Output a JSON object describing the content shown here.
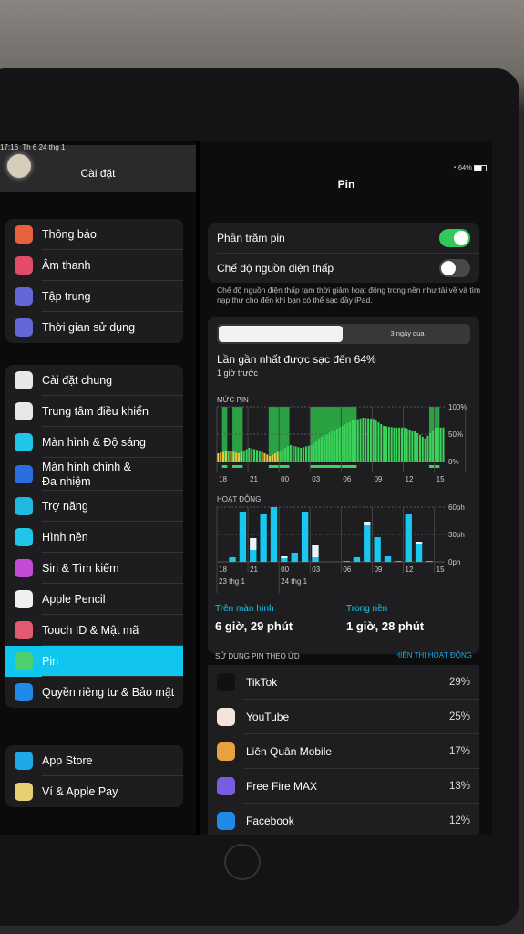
{
  "status": {
    "time": "17:16",
    "date": "Th 6 24 thg 1",
    "battery": "64%"
  },
  "sidebar": {
    "title": "Cài đặt",
    "groups": [
      [
        {
          "label": "Thông báo",
          "icon": "bell-icon",
          "color": "#e8603c"
        },
        {
          "label": "Âm thanh",
          "icon": "speaker-icon",
          "color": "#e44a6a"
        },
        {
          "label": "Tập trung",
          "icon": "moon-icon",
          "color": "#6366d8"
        },
        {
          "label": "Thời gian sử dụng",
          "icon": "hourglass-icon",
          "color": "#6366d8"
        }
      ],
      [
        {
          "label": "Cài đặt chung",
          "icon": "gear-icon",
          "color": "#e8e8e8"
        },
        {
          "label": "Trung tâm điều khiển",
          "icon": "switches-icon",
          "color": "#e8e8e8"
        },
        {
          "label": "Màn hình & Độ sáng",
          "icon": "text-size-icon",
          "color": "#1fc6e8"
        },
        {
          "label": "Màn hình chính & Đa nhiệm",
          "icon": "grid-icon",
          "color": "#2a6fe0"
        },
        {
          "label": "Trợ năng",
          "icon": "accessibility-icon",
          "color": "#1fb8e0"
        },
        {
          "label": "Hình nền",
          "icon": "flower-icon",
          "color": "#1fc6e8"
        },
        {
          "label": "Siri & Tìm kiếm",
          "icon": "siri-icon",
          "color": "#c24bd6"
        },
        {
          "label": "Apple Pencil",
          "icon": "pencil-icon",
          "color": "#f0f0f0"
        },
        {
          "label": "Touch ID & Mật mã",
          "icon": "fingerprint-icon",
          "color": "#e05a70"
        },
        {
          "label": "Pin",
          "icon": "battery-icon",
          "color": "#4cd070",
          "selected": true
        },
        {
          "label": "Quyền riêng tư & Bảo mật",
          "icon": "hand-icon",
          "color": "#1f8ae8"
        }
      ],
      [
        {
          "label": "App Store",
          "icon": "app-store-icon",
          "color": "#1fa8e8"
        },
        {
          "label": "Ví & Apple Pay",
          "icon": "wallet-icon",
          "color": "#e8d070"
        }
      ]
    ]
  },
  "main": {
    "title": "Pin",
    "battery_percentage": {
      "label": "Phần trăm pin",
      "on": true
    },
    "low_power": {
      "label": "Chế độ nguồn điện thấp",
      "on": false
    },
    "low_power_footer": "Chế độ nguồn điện thấp tạm thời giảm hoạt động trong nền như tải về và tìm nạp thư cho đến khi bạn có thể sạc đầy iPad.",
    "range_tabs": [
      "",
      "3 ngày qua"
    ],
    "last_charge": "Lần gần nhất được sạc đến 64%",
    "last_charge_time": "1 giờ trước",
    "screen_on": {
      "label": "Trên màn hình",
      "value": "6 giờ, 29 phút"
    },
    "background": {
      "label": "Trong nền",
      "value": "1 giờ, 28 phút"
    },
    "usage_header": "SỬ DỤNG PIN THEO ỨD",
    "show_activity": "HIỂN THỊ HOẠT ĐỘNG",
    "apps": [
      {
        "name": "TikTok",
        "pct": "29%",
        "icon": "tiktok-icon",
        "color": "#111"
      },
      {
        "name": "YouTube",
        "pct": "25%",
        "icon": "youtube-icon",
        "color": "#f4e4dc"
      },
      {
        "name": "Liên Quân Mobile",
        "pct": "17%",
        "icon": "game-icon",
        "color": "#e8a040"
      },
      {
        "name": "Free Fire MAX",
        "pct": "13%",
        "icon": "game-icon",
        "color": "#7a5ce0"
      },
      {
        "name": "Facebook",
        "pct": "12%",
        "icon": "facebook-icon",
        "color": "#1f8ae8"
      }
    ]
  },
  "chart_data": [
    {
      "type": "area",
      "title": "MỨC PIN",
      "x": [
        "18",
        "19",
        "20",
        "21",
        "22",
        "23",
        "00",
        "01",
        "02",
        "03",
        "04",
        "05",
        "06",
        "07",
        "08",
        "09",
        "10",
        "11",
        "12",
        "13",
        "14",
        "15",
        "16"
      ],
      "values": [
        15,
        20,
        15,
        25,
        20,
        10,
        20,
        30,
        25,
        30,
        45,
        55,
        65,
        75,
        80,
        78,
        65,
        62,
        62,
        55,
        42,
        62,
        62
      ],
      "charging_hours": [
        [
          "18.5",
          "19"
        ],
        [
          "19.5",
          "20.5"
        ],
        [
          "23",
          "01"
        ],
        [
          "03",
          "07.5"
        ],
        [
          "14.5",
          "15.5"
        ]
      ],
      "x_ticks": [
        "18",
        "21",
        "00",
        "03",
        "06",
        "09",
        "12",
        "15"
      ],
      "y_ticks": [
        "100%",
        "50%",
        "0%"
      ],
      "ylim": [
        0,
        100
      ],
      "color": "#3ad45a"
    },
    {
      "type": "bar",
      "title": "HOẠT ĐỘNG",
      "x": [
        "18",
        "19",
        "20",
        "21",
        "22",
        "23",
        "00",
        "01",
        "02",
        "03",
        "04",
        "05",
        "06",
        "07",
        "08",
        "09",
        "10",
        "11",
        "12",
        "13",
        "14",
        "15"
      ],
      "series": [
        {
          "name": "Trên màn hình",
          "values": [
            0,
            5,
            55,
            13,
            52,
            60,
            4,
            10,
            55,
            5,
            0,
            0,
            1,
            5,
            40,
            27,
            6,
            1,
            52,
            20,
            1,
            0
          ],
          "color": "#19c8f0"
        },
        {
          "name": "Trong nền",
          "values": [
            0,
            0,
            0,
            13,
            0,
            0,
            2,
            0,
            0,
            14,
            0,
            0,
            0,
            0,
            4,
            0,
            0,
            0,
            0,
            2,
            0,
            0
          ],
          "color": "#e8f4f8"
        }
      ],
      "x_ticks": [
        "18",
        "21",
        "00",
        "03",
        "06",
        "09",
        "12",
        "15"
      ],
      "date_labels": [
        "23 thg 1",
        "24 thg 1"
      ],
      "y_ticks": [
        "60ph",
        "30ph",
        "0ph"
      ],
      "ylim": [
        0,
        60
      ]
    }
  ]
}
